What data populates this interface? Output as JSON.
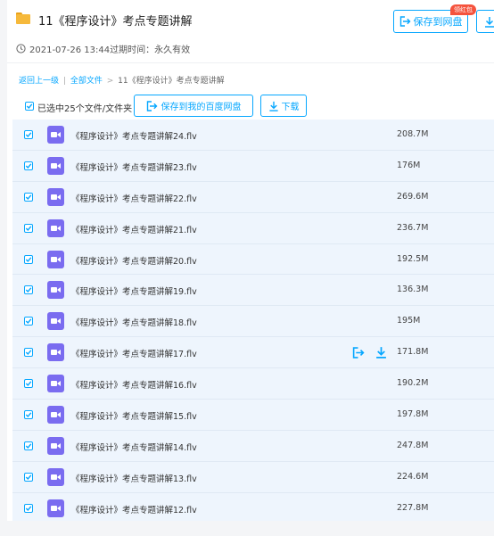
{
  "header": {
    "title": "11《程序设计》考点专题讲解",
    "save_label": "保存到网盘",
    "badge": "领红包",
    "meta_text": "2021-07-26 13:44过期时间：永久有效"
  },
  "breadcrumb": {
    "back": "返回上一级",
    "sep": "|",
    "all_files": "全部文件",
    "arrow": ">",
    "current": "11《程序设计》考点专题讲解"
  },
  "toolbar": {
    "selected_text": "已选中25个文件/文件夹",
    "save_baidu_label": "保存到我的百度网盘",
    "download_label": "下载"
  },
  "files": [
    {
      "name": "《程序设计》考点专题讲解24.flv",
      "size": "208.7M"
    },
    {
      "name": "《程序设计》考点专题讲解23.flv",
      "size": "176M"
    },
    {
      "name": "《程序设计》考点专题讲解22.flv",
      "size": "269.6M"
    },
    {
      "name": "《程序设计》考点专题讲解21.flv",
      "size": "236.7M"
    },
    {
      "name": "《程序设计》考点专题讲解20.flv",
      "size": "192.5M"
    },
    {
      "name": "《程序设计》考点专题讲解19.flv",
      "size": "136.3M"
    },
    {
      "name": "《程序设计》考点专题讲解18.flv",
      "size": "195M"
    },
    {
      "name": "《程序设计》考点专题讲解17.flv",
      "size": "171.8M"
    },
    {
      "name": "《程序设计》考点专题讲解16.flv",
      "size": "190.2M"
    },
    {
      "name": "《程序设计》考点专题讲解15.flv",
      "size": "197.8M"
    },
    {
      "name": "《程序设计》考点专题讲解14.flv",
      "size": "247.8M"
    },
    {
      "name": "《程序设计》考点专题讲解13.flv",
      "size": "224.6M"
    },
    {
      "name": "《程序设计》考点专题讲解12.flv",
      "size": "227.8M"
    }
  ],
  "icons": {
    "folder": "folder-icon",
    "clock": "clock-icon",
    "save": "save-to-cloud-icon",
    "download": "download-icon",
    "video": "video-file-icon",
    "checkbox": "checkbox-checked-icon"
  },
  "colors": {
    "accent": "#06a7ff",
    "badge": "#f5533d",
    "video_icon": "#7a6cf0",
    "row_selected_bg": "#eef5fd",
    "folder": "#f6b93b"
  }
}
